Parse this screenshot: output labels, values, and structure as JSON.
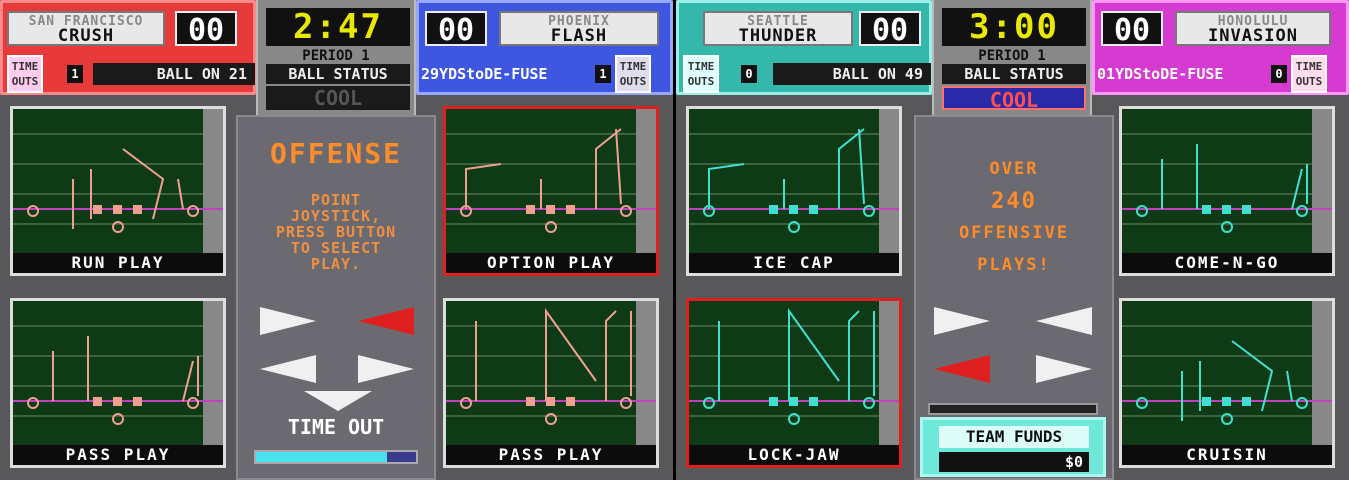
{
  "left": {
    "home": {
      "city": "SAN FRANCISCO",
      "name": "CRUSH",
      "score": "00",
      "timeouts_label": [
        "TIME",
        "OUTS"
      ],
      "timeouts": "1"
    },
    "away": {
      "city": "PHOENIX",
      "name": "FLASH",
      "score": "00",
      "timeouts_label": [
        "TIME",
        "OUTS"
      ],
      "timeouts": "1"
    },
    "clock": "2:47",
    "period": "PERIOD 1",
    "ball_on": "BALL ON 21",
    "ball_status_label": "BALL STATUS",
    "ball_status": "COOL",
    "yds_to_defuse": "29YDStoDE-FUSE",
    "center": {
      "title": "OFFENSE",
      "instructions": [
        "POINT",
        "JOYSTICK,",
        "PRESS BUTTON",
        "TO  SELECT",
        "PLAY."
      ],
      "time_out": "TIME OUT",
      "timeout_meter": 0.82
    },
    "plays": [
      {
        "label": "RUN PLAY",
        "selected": false
      },
      {
        "label": "OPTION PLAY",
        "selected": true
      },
      {
        "label": "PASS PLAY",
        "selected": false
      },
      {
        "label": "PASS PLAY",
        "selected": false
      }
    ]
  },
  "right": {
    "home": {
      "city": "SEATTLE",
      "name": "THUNDER",
      "score": "00",
      "timeouts_label": [
        "TIME",
        "OUTS"
      ],
      "timeouts": "0"
    },
    "away": {
      "city": "HONOLULU",
      "name": "INVASION",
      "score": "00",
      "timeouts_label": [
        "TIME",
        "OUTS"
      ],
      "timeouts": "0"
    },
    "clock": "3:00",
    "period": "PERIOD 1",
    "ball_on": "BALL ON 49",
    "ball_status_label": "BALL STATUS",
    "ball_status": "COOL",
    "yds_to_defuse": "01YDStoDE-FUSE",
    "center": {
      "promo": [
        "OVER",
        "240",
        "OFFENSIVE",
        "PLAYS!"
      ],
      "team_funds_label": "TEAM FUNDS",
      "team_funds": "$0"
    },
    "plays": [
      {
        "label": "ICE CAP",
        "selected": false
      },
      {
        "label": "COME-N-GO",
        "selected": false
      },
      {
        "label": "LOCK-JAW",
        "selected": true
      },
      {
        "label": "CRUISIN",
        "selected": false
      }
    ]
  },
  "colors": {
    "field": "#0e3a16",
    "left_route": "#f0a090",
    "right_route": "#40e0d0",
    "scrimmage": "#c040c0",
    "highlight_arrow": "#e02020"
  }
}
